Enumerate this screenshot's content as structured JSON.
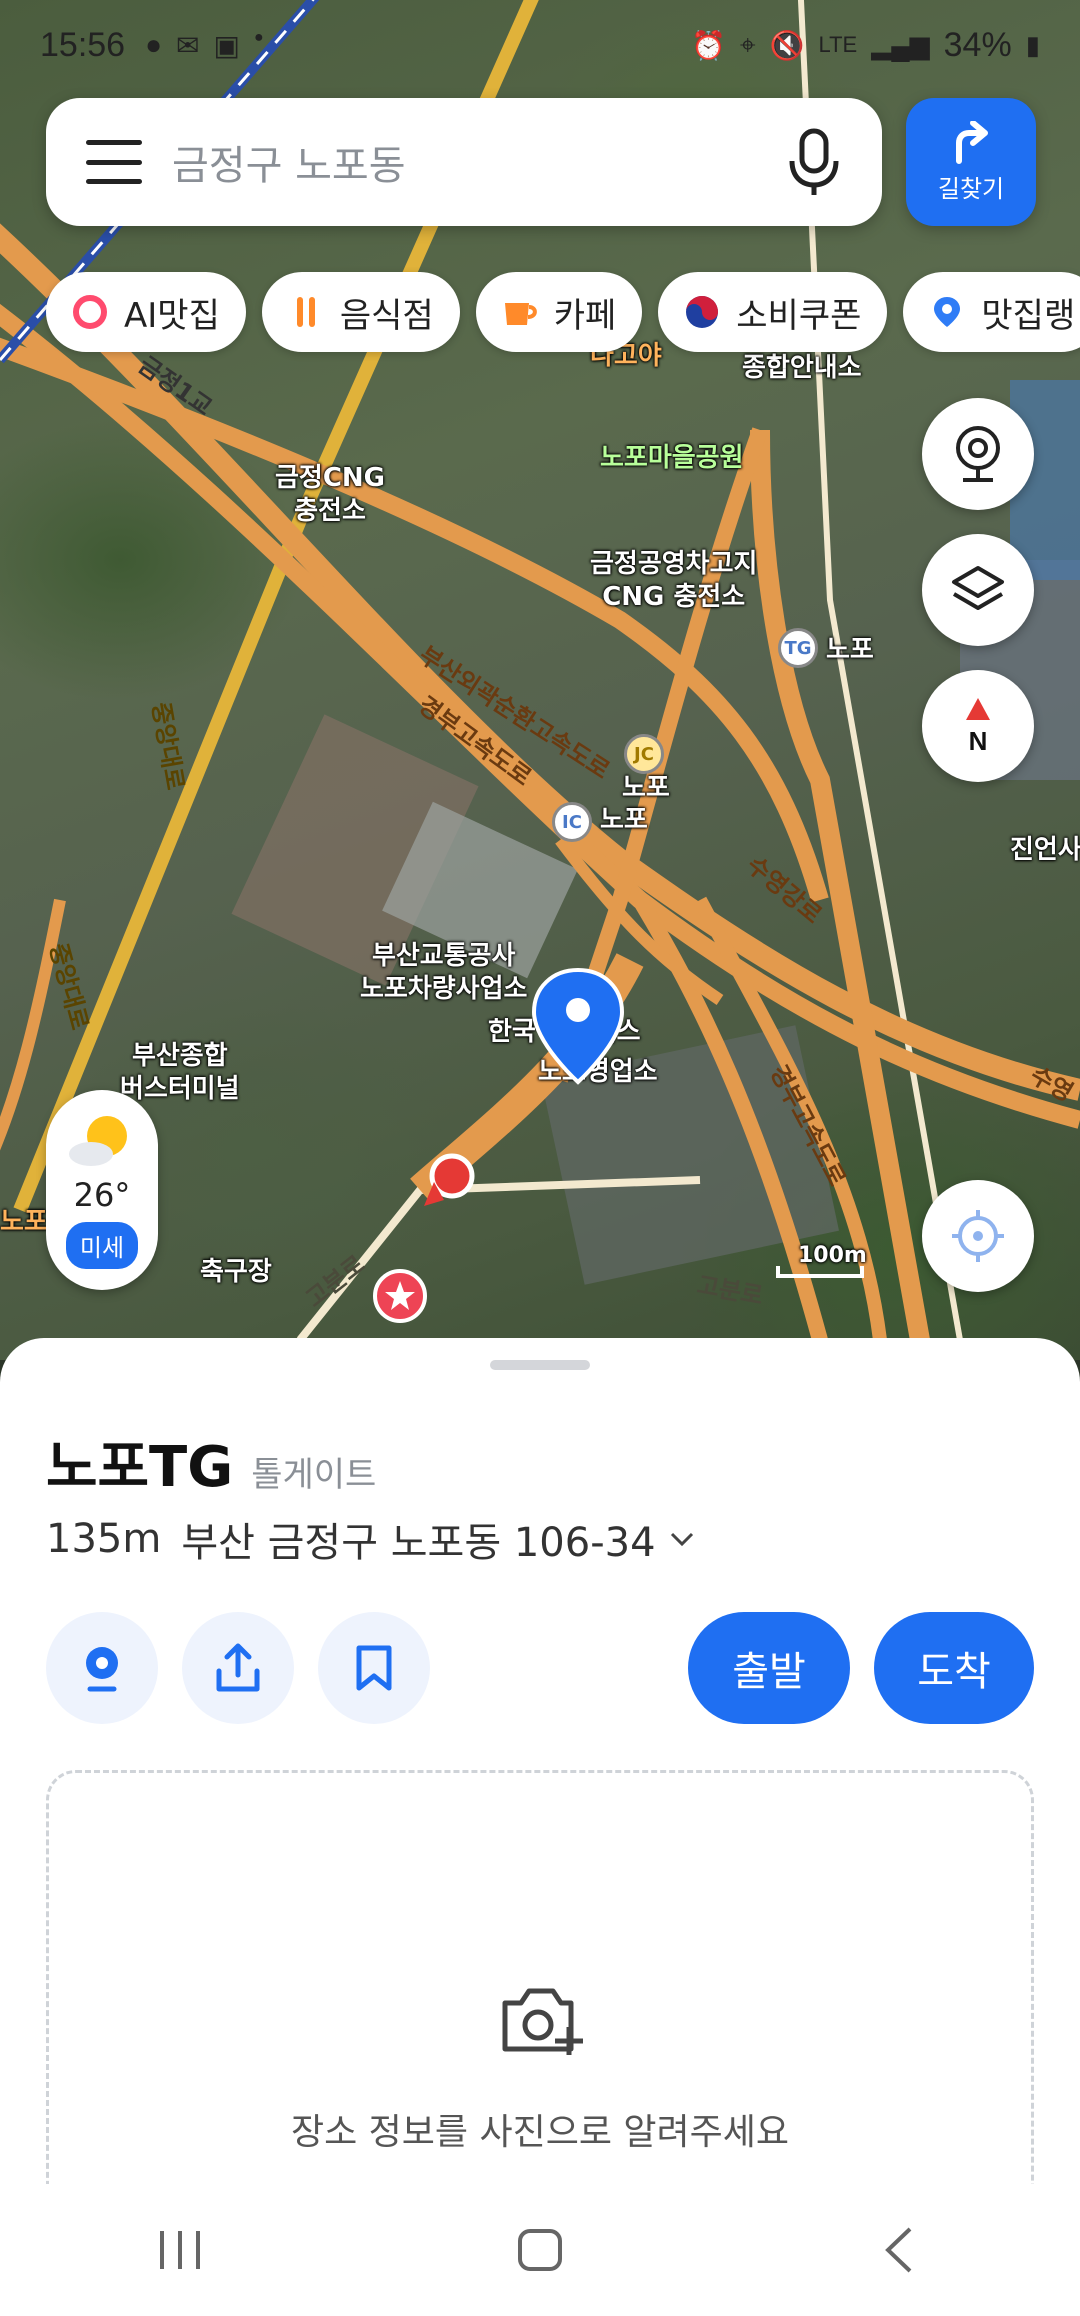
{
  "status_bar": {
    "time": "15:56",
    "left_icons": [
      "talk-icon",
      "mail-icon",
      "gallery-icon",
      "dot-icon"
    ],
    "battery": "34%",
    "right_icons": [
      "alarm-icon",
      "location-icon",
      "mute-icon",
      "lte-icon",
      "signal-icon",
      "battery-icon"
    ],
    "network": "LTE"
  },
  "search": {
    "placeholder": "금정구 노포동"
  },
  "route_button": {
    "label": "길찾기"
  },
  "chips": [
    {
      "label": "AI맛집",
      "icon": "ai-ring-icon",
      "color": "#ff4b6e"
    },
    {
      "label": "음식점",
      "icon": "fork-spoon-icon",
      "color": "#ff8a2a"
    },
    {
      "label": "카페",
      "icon": "cup-icon",
      "color": "#ff8a2a"
    },
    {
      "label": "소비쿠폰",
      "icon": "taegeuk-icon",
      "color": "#d01f3c"
    },
    {
      "label": "맛집랭",
      "icon": "map-pin-icon",
      "color": "#2f7cf6"
    }
  ],
  "map": {
    "labels": {
      "nakoya": "나고야",
      "info_center": "종합안내소",
      "park": "노포마을공원",
      "cng": "금정CNG\n충전소",
      "gongyoung": "금정공영차고지\nCNG 충전소",
      "tg": "노포",
      "jc": "노포",
      "ic": "노포",
      "jinyeon": "진언사",
      "busan_transit": "부산교통공사\n노포차량사업소",
      "korea_service": "한국    사서비스",
      "nopo_office": "노포영업소",
      "terminal": "부산종합\n버스터미널",
      "soccer": "축구장",
      "nopo_left": "노포",
      "scale": "100m",
      "road_busan_outer": "부산외곽순환고속도로",
      "road_gyeongbu": "경부고속도로",
      "road_suyeong": "수영강로",
      "road_jungang": "중앙대로",
      "road_jungang2": "중앙대로",
      "road_gobun": "고분로",
      "road_gobun2": "고분로",
      "road_expressway": "경부고속도로",
      "road_geumjeong": "금정1교",
      "road_suyeong2": "수영"
    },
    "badges": {
      "tg": "TG",
      "jc": "JC",
      "ic": "IC"
    },
    "accent": "#e39a4d"
  },
  "weather": {
    "temp": "26°",
    "dust": "미세"
  },
  "place": {
    "name": "노포TG",
    "category": "톨게이트",
    "distance": "135m",
    "address": "부산 금정구 노포동 106-34"
  },
  "actions": {
    "depart": "출발",
    "arrive": "도착"
  },
  "photo": {
    "message": "장소 정보를 사진으로 알려주세요"
  },
  "colors": {
    "primary": "#1f6ff2",
    "action_bg": "#eef3fd"
  }
}
